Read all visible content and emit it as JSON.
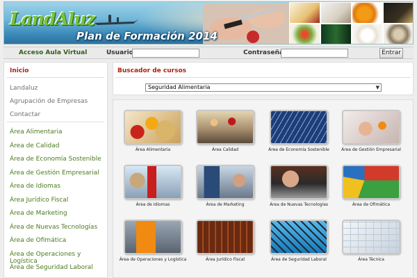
{
  "banner": {
    "logo_text": "LandAluz",
    "title": "Plan de Formación 2014"
  },
  "login": {
    "aula_link": "Acceso Aula Virtual",
    "user_label": "Usuario",
    "user_value": "",
    "pass_label": "Contraseña",
    "pass_value": "",
    "submit_label": "Entrar"
  },
  "sidebar": {
    "header": "Inicio",
    "links": [
      "Landaluz",
      "Agrupación de Empresas",
      "Contactar"
    ],
    "areas": [
      "Área Alimentaria",
      "Área de Calidad",
      "Área de Economía Sostenible",
      "Área de Gestión Empresarial",
      "Área de Idiomas",
      "Área Jurídico Fiscal",
      "Área de Marketing",
      "Área de Nuevas Tecnologías",
      "Área de Ofimática",
      "Área de Operaciones y Logística",
      "Área de Seguridad Laboral"
    ]
  },
  "search": {
    "title": "Buscador de cursos",
    "selected": "Seguridad Alimentaria"
  },
  "tiles": [
    {
      "label": "Área Alimentaria",
      "image": "food-image"
    },
    {
      "label": "Área Calidad",
      "image": "workers-image"
    },
    {
      "label": "Área de Economía Sostenible",
      "image": "solar-panels-image"
    },
    {
      "label": "Área de Gestión Empresarial",
      "image": "business-hands-image"
    },
    {
      "label": "Área de Idiomas",
      "image": "london-image"
    },
    {
      "label": "Área de Marketing",
      "image": "computer-desk-image"
    },
    {
      "label": "Área de Nuevas Tecnologías",
      "image": "phone-laptop-image"
    },
    {
      "label": "Área de Ofimática",
      "image": "monitor-chart-image"
    },
    {
      "label": "Área de Operaciones y Logística",
      "image": "forklift-image"
    },
    {
      "label": "Área Jurídico Fiscal",
      "image": "law-books-image"
    },
    {
      "label": "Área de Seguridad Laboral",
      "image": "crane-image"
    },
    {
      "label": "Área Técnica",
      "image": "blueprint-image"
    }
  ],
  "colors": {
    "accent_red": "#aa2211",
    "link_green": "#4a7a1c",
    "logo_green": "#7ac142"
  }
}
